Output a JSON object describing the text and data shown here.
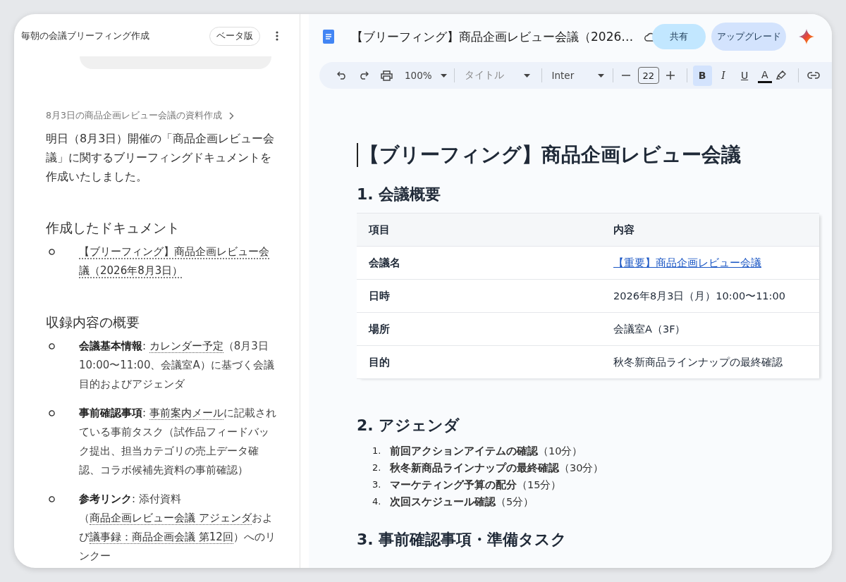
{
  "assistant": {
    "title": "毎朝の会議ブリーフィング作成",
    "badge": "ベータ版",
    "breadcrumb": "8月3日の商品企画レビュー会議の資料作成",
    "intro": "明日（8月3日）開催の「商品企画レビュー会議」に関するブリーフィングドキュメントを作成いたしました。",
    "sections": [
      {
        "heading": "作成したドキュメント",
        "items": [
          {
            "segments": [
              {
                "kind": "link",
                "text": "【ブリーフィング】商品企画レビュー会議（2026年8月3日）"
              }
            ]
          }
        ]
      },
      {
        "heading": "収録内容の概要",
        "items": [
          {
            "segments": [
              {
                "kind": "bold",
                "text": "会議基本情報"
              },
              {
                "kind": "text",
                "text": ": "
              },
              {
                "kind": "link",
                "text": "カレンダー予定"
              },
              {
                "kind": "text",
                "text": "（8月3日 10:00〜11:00、会議室A）に基づく会議目的およびアジェンダ"
              }
            ]
          },
          {
            "segments": [
              {
                "kind": "bold",
                "text": "事前確認事項"
              },
              {
                "kind": "text",
                "text": ": "
              },
              {
                "kind": "link",
                "text": "事前案内メール"
              },
              {
                "kind": "text",
                "text": "に記載されている事前タスク（試作品フィードバック提出、担当カテゴリの売上データ確認、コラボ候補先資料の事前確認）"
              }
            ]
          },
          {
            "segments": [
              {
                "kind": "bold",
                "text": "参考リンク"
              },
              {
                "kind": "text",
                "text": ": 添付資料（"
              },
              {
                "kind": "link",
                "text": "商品企画レビュー会議 アジェンダ"
              },
              {
                "kind": "text",
                "text": "および"
              },
              {
                "kind": "link",
                "text": "議事録：商品企画会議 第12回"
              },
              {
                "kind": "text",
                "text": "）へのリンクー"
              }
            ]
          }
        ]
      }
    ]
  },
  "document": {
    "file_title": "【ブリーフィング】商品企画レビュー会議（2026…",
    "share": "共有",
    "upgrade": "アップグレード",
    "toolbar": {
      "zoom": "100%",
      "style": "タイトル",
      "font": "Inter",
      "font_size": "22",
      "format_buttons": [
        {
          "kind": "bold",
          "label": "B",
          "selected": true
        },
        {
          "kind": "italic",
          "label": "I",
          "selected": false
        },
        {
          "kind": "underline",
          "label": "U",
          "selected": false
        },
        {
          "kind": "text_color",
          "label": "A",
          "selected": false
        }
      ]
    },
    "title": "【ブリーフィング】商品企画レビュー会議",
    "sections": [
      {
        "heading": "1. 会議概要",
        "kind": "table",
        "columns": [
          "項目",
          "内容"
        ],
        "rows": [
          {
            "label": "会議名",
            "value": "【重要】商品企画レビュー会議",
            "kind": "link"
          },
          {
            "label": "日時",
            "value": "2026年8月3日（月）10:00〜11:00",
            "kind": "text"
          },
          {
            "label": "場所",
            "value": "会議室A（3F）",
            "kind": "text"
          },
          {
            "label": "目的",
            "value": "秋冬新商品ラインナップの最終確認",
            "kind": "text"
          }
        ]
      },
      {
        "heading": "2. アジェンダ",
        "kind": "ordered_list",
        "items": [
          {
            "number": "1.",
            "text": "**前回アクションアイテムの確認**（10分）"
          },
          {
            "number": "2.",
            "text": "**秋冬新商品ラインナップの最終確認**（30分）"
          },
          {
            "number": "3.",
            "text": "**マーケティング予算の配分**（15分）"
          },
          {
            "number": "4.",
            "text": "**次回スケジュール確認**（5分）"
          }
        ]
      },
      {
        "heading": "3. 事前確認事項・準備タスク",
        "kind": "heading_only"
      }
    ]
  }
}
